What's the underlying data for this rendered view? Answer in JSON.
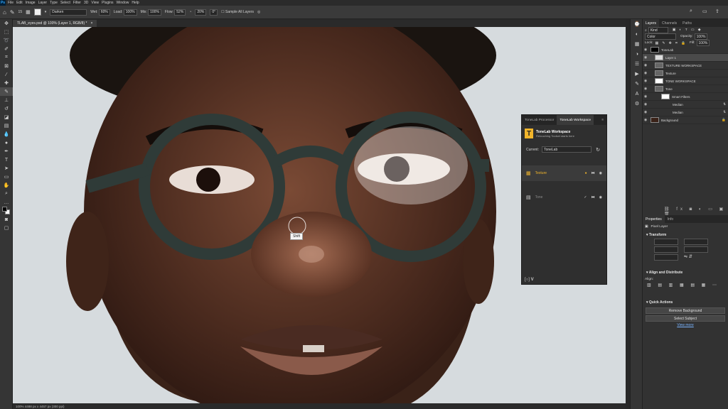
{
  "menubar": {
    "logo": "Ps",
    "items": [
      "File",
      "Edit",
      "Image",
      "Layer",
      "Type",
      "Select",
      "Filter",
      "3D",
      "View",
      "Plugins",
      "Window",
      "Help"
    ]
  },
  "options": {
    "brush_size": "15",
    "mode_label": "Mode:",
    "mode": "Darken",
    "wet_label": "Wet:",
    "wet": "60%",
    "load_label": "Load:",
    "load": "100%",
    "mix_label": "Mix:",
    "mix": "100%",
    "flow_label": "Flow:",
    "flow": "52%",
    "angle": "20%",
    "angle2": "0°",
    "sample_all": "Sample All Layers"
  },
  "document": {
    "tab_title": "TLAB_eyes.psd @ 100% (Layer 1, RGB/8) *",
    "status": "100%   4488 px x 4457 px (300 ppi)"
  },
  "canvas": {
    "cursor_label": "Shift"
  },
  "tonelab": {
    "tabs": [
      "ToneLab Processor",
      "ToneLab Workspace"
    ],
    "brand_title": "ToneLab Workspace",
    "brand_sub": "Retouching Toolset starts here",
    "current_label": "Current:",
    "current_value": "ToneLab",
    "rows": [
      {
        "label": "Texture"
      },
      {
        "label": "Tone"
      }
    ]
  },
  "layers_panel": {
    "tabs": [
      "Layers",
      "Channels",
      "Paths"
    ],
    "kind": "Kind",
    "blend_mode": "Color",
    "opacity_label": "Opacity:",
    "opacity": "100%",
    "lock_label": "Lock:",
    "fill_label": "Fill:",
    "fill": "100%",
    "layers": [
      {
        "name": "ToneLab",
        "indent": 0
      },
      {
        "name": "Layer 1",
        "indent": 1
      },
      {
        "name": "TEXTURE WORKSPACE",
        "indent": 1
      },
      {
        "name": "Texture",
        "indent": 1
      },
      {
        "name": "TONE WORKSPACE",
        "indent": 1
      },
      {
        "name": "Tone",
        "indent": 1
      },
      {
        "name": "Smart Filters",
        "indent": 2
      },
      {
        "name": "Median",
        "indent": 3
      },
      {
        "name": "Median",
        "indent": 3
      },
      {
        "name": "Background",
        "indent": 0
      }
    ]
  },
  "properties_panel": {
    "tabs": [
      "Properties",
      "Info"
    ],
    "layer_type": "Pixel Layer",
    "transform": "Transform",
    "align": "Align and Distribute",
    "align_label": "Align:",
    "quick_actions": "Quick Actions",
    "remove_bg": "Remove Background",
    "select_subject": "Select Subject",
    "view_more": "View more"
  }
}
